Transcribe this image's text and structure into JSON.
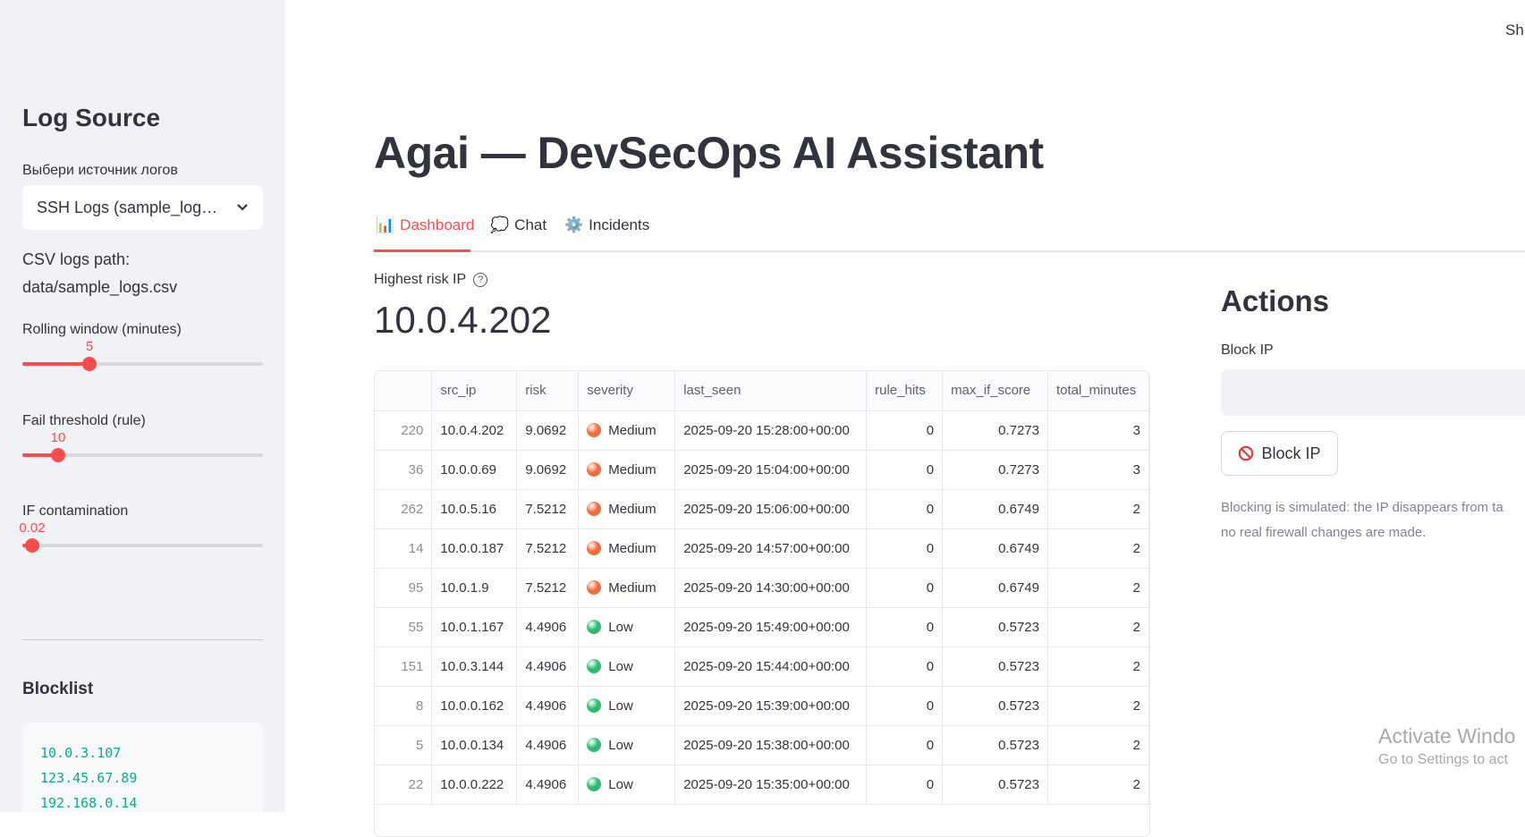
{
  "sidebar": {
    "heading": "Log Source",
    "source_label": "Выбери источник логов",
    "source_value": "SSH Logs (sample_logs.csv)",
    "csv_path_label": "CSV logs path:",
    "csv_path_value": "data/sample_logs.csv",
    "rolling_window": {
      "label": "Rolling window (minutes)",
      "value": "5",
      "fraction": 0.28
    },
    "fail_threshold": {
      "label": "Fail threshold (rule)",
      "value": "10",
      "fraction": 0.15
    },
    "if_contamination": {
      "label": "IF contamination",
      "value": "0.02",
      "fraction": 0.04
    },
    "blocklist_heading": "Blocklist",
    "blocklist": [
      "10.0.3.107",
      "123.45.67.89",
      "192.168.0.14"
    ]
  },
  "topright": "Sh",
  "title": "Agai — DevSecOps AI Assistant",
  "tabs": [
    {
      "label": "Dashboard",
      "icon": "bar-chart-icon",
      "glyph": "📊"
    },
    {
      "label": "Chat",
      "icon": "speech-bubble-icon",
      "glyph": "💭"
    },
    {
      "label": "Incidents",
      "icon": "gear-icon",
      "glyph": "⚙️"
    }
  ],
  "metric": {
    "label": "Highest risk IP",
    "value": "10.0.4.202"
  },
  "table": {
    "columns": [
      "",
      "src_ip",
      "risk",
      "severity",
      "last_seen",
      "rule_hits",
      "max_if_score",
      "total_minutes"
    ],
    "rows": [
      {
        "idx": "220",
        "src_ip": "10.0.4.202",
        "risk": "9.0692",
        "severity": "Medium",
        "last_seen": "2025-09-20 15:28:00+00:00",
        "rule_hits": "0",
        "max_if_score": "0.7273",
        "total_minutes": "3"
      },
      {
        "idx": "36",
        "src_ip": "10.0.0.69",
        "risk": "9.0692",
        "severity": "Medium",
        "last_seen": "2025-09-20 15:04:00+00:00",
        "rule_hits": "0",
        "max_if_score": "0.7273",
        "total_minutes": "3"
      },
      {
        "idx": "262",
        "src_ip": "10.0.5.16",
        "risk": "7.5212",
        "severity": "Medium",
        "last_seen": "2025-09-20 15:06:00+00:00",
        "rule_hits": "0",
        "max_if_score": "0.6749",
        "total_minutes": "2"
      },
      {
        "idx": "14",
        "src_ip": "10.0.0.187",
        "risk": "7.5212",
        "severity": "Medium",
        "last_seen": "2025-09-20 14:57:00+00:00",
        "rule_hits": "0",
        "max_if_score": "0.6749",
        "total_minutes": "2"
      },
      {
        "idx": "95",
        "src_ip": "10.0.1.9",
        "risk": "7.5212",
        "severity": "Medium",
        "last_seen": "2025-09-20 14:30:00+00:00",
        "rule_hits": "0",
        "max_if_score": "0.6749",
        "total_minutes": "2"
      },
      {
        "idx": "55",
        "src_ip": "10.0.1.167",
        "risk": "4.4906",
        "severity": "Low",
        "last_seen": "2025-09-20 15:49:00+00:00",
        "rule_hits": "0",
        "max_if_score": "0.5723",
        "total_minutes": "2"
      },
      {
        "idx": "151",
        "src_ip": "10.0.3.144",
        "risk": "4.4906",
        "severity": "Low",
        "last_seen": "2025-09-20 15:44:00+00:00",
        "rule_hits": "0",
        "max_if_score": "0.5723",
        "total_minutes": "2"
      },
      {
        "idx": "8",
        "src_ip": "10.0.0.162",
        "risk": "4.4906",
        "severity": "Low",
        "last_seen": "2025-09-20 15:39:00+00:00",
        "rule_hits": "0",
        "max_if_score": "0.5723",
        "total_minutes": "2"
      },
      {
        "idx": "5",
        "src_ip": "10.0.0.134",
        "risk": "4.4906",
        "severity": "Low",
        "last_seen": "2025-09-20 15:38:00+00:00",
        "rule_hits": "0",
        "max_if_score": "0.5723",
        "total_minutes": "2"
      },
      {
        "idx": "22",
        "src_ip": "10.0.0.222",
        "risk": "4.4906",
        "severity": "Low",
        "last_seen": "2025-09-20 15:35:00+00:00",
        "rule_hits": "0",
        "max_if_score": "0.5723",
        "total_minutes": "2"
      }
    ]
  },
  "severity_colors": {
    "Medium": "#f26b3a",
    "Low": "#2bbd6e"
  },
  "actions": {
    "heading": "Actions",
    "block_label": "Block IP",
    "block_input_value": "",
    "block_button": "Block IP",
    "note_line1": "Blocking is simulated: the IP disappears from ta",
    "note_line2": "no real firewall changes are made."
  },
  "watermark": {
    "line1": "Activate Windo",
    "line2": "Go to Settings to act"
  },
  "colors": {
    "accent": "#ff4b4b",
    "sidebar_bg": "#f0f2f6",
    "code_text": "#09ab8c"
  }
}
